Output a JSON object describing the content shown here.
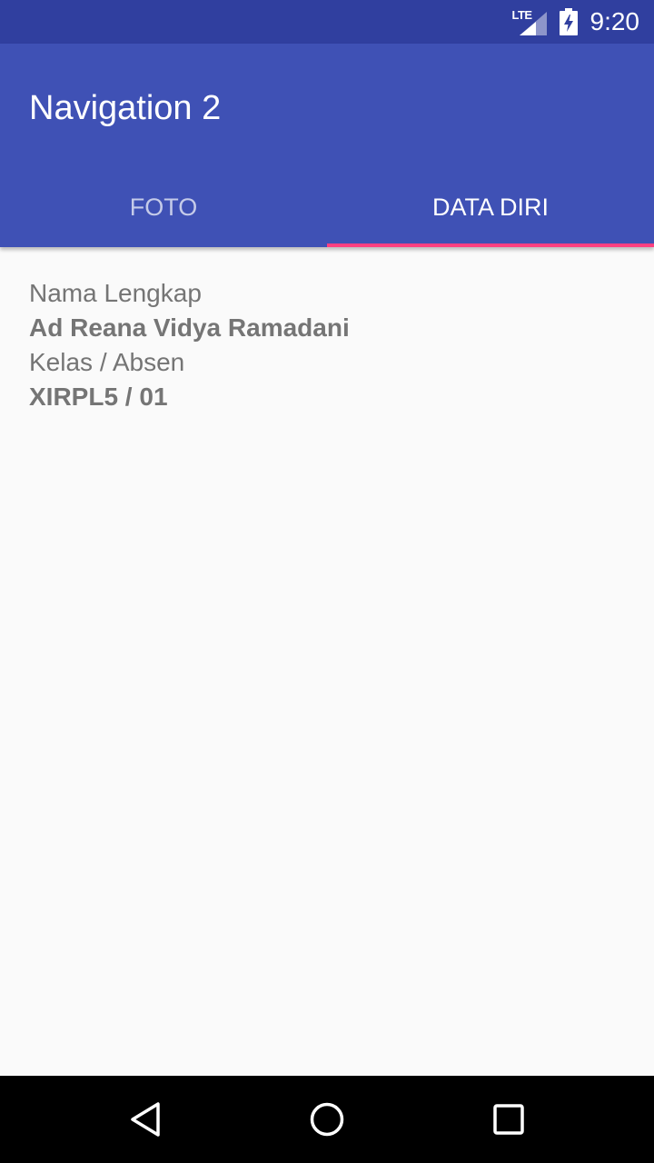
{
  "status_bar": {
    "network": "LTE",
    "time": "9:20",
    "icons": [
      "lte-signal-icon",
      "battery-charging-icon"
    ]
  },
  "app_bar": {
    "title": "Navigation 2",
    "color": "#3f51b5",
    "status_color": "#303f9f",
    "accent": "#ff4081"
  },
  "tabs": [
    {
      "label": "FOTO",
      "selected": false
    },
    {
      "label": "DATA DIRI",
      "selected": true
    }
  ],
  "content": {
    "name_label": "Nama Lengkap",
    "name_value": "Ad Reana Vidya Ramadani",
    "class_label": "Kelas / Absen",
    "class_value": "XIRPL5 / 01"
  },
  "nav_bar": {
    "icons": [
      "back-icon",
      "home-icon",
      "recents-icon"
    ]
  }
}
